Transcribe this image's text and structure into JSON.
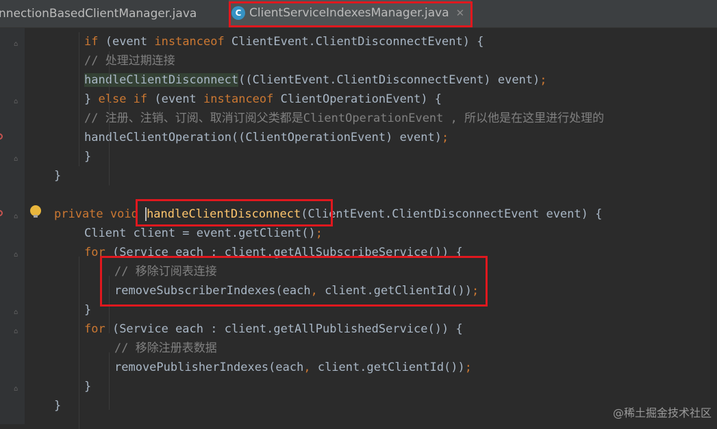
{
  "tabs": [
    {
      "label": "nnectionBasedClientManager.java"
    },
    {
      "label": "ClientServiceIndexesManager.java",
      "icon": "C",
      "close": "✕"
    }
  ],
  "code": {
    "lines": [
      [
        [
          "if",
          "kw"
        ],
        [
          " (event ",
          ""
        ],
        [
          "instanceof",
          "kw"
        ],
        [
          " ClientEvent.ClientDisconnectEvent) {",
          ""
        ]
      ],
      [
        [
          "// 处理过期连接",
          "cm"
        ]
      ],
      [
        [
          "handleClientDisconnect",
          "hl"
        ],
        [
          "((ClientEvent.ClientDisconnectEvent) event)",
          ""
        ],
        [
          ";",
          "sc"
        ]
      ],
      [
        [
          "} ",
          ""
        ],
        [
          "else if",
          "kw"
        ],
        [
          " (event ",
          ""
        ],
        [
          "instanceof",
          "kw"
        ],
        [
          " ClientOperationEvent) {",
          ""
        ]
      ],
      [
        [
          "// 注册、注销、订阅、取消订阅父类都是ClientOperationEvent , 所以他是在这里进行处理的",
          "cm"
        ]
      ],
      [
        [
          "handleClientOperation((ClientOperationEvent) event)",
          ""
        ],
        [
          ";",
          "sc"
        ]
      ],
      [
        [
          "}",
          ""
        ]
      ],
      [
        [
          "}",
          ""
        ]
      ],
      [],
      [
        [
          "private void ",
          "kw"
        ],
        [
          "handleClientDisconnect",
          "fn"
        ],
        [
          "(ClientEvent.ClientDisconnectEvent event) {",
          ""
        ]
      ],
      [
        [
          "Client client = event.getClient()",
          ""
        ],
        [
          ";",
          "sc"
        ]
      ],
      [
        [
          "for",
          "kw"
        ],
        [
          " (Service each : client.getAllSubscribeService()) {",
          ""
        ]
      ],
      [
        [
          "// 移除订阅表连接",
          "cm"
        ]
      ],
      [
        [
          "removeSubscriberIndexes(each",
          ""
        ],
        [
          ",",
          "sc"
        ],
        [
          " client.getClientId())",
          ""
        ],
        [
          ";",
          "sc"
        ]
      ],
      [
        [
          "}",
          ""
        ]
      ],
      [
        [
          "for",
          "kw"
        ],
        [
          " (Service each : client.getAllPublishedService()) {",
          ""
        ]
      ],
      [
        [
          "// 移除注册表数据",
          "cm"
        ]
      ],
      [
        [
          "removePublisherIndexes(each",
          ""
        ],
        [
          ",",
          "sc"
        ],
        [
          " client.getClientId())",
          ""
        ],
        [
          ";",
          "sc"
        ]
      ],
      [
        [
          "}",
          ""
        ]
      ],
      [
        [
          "}",
          ""
        ]
      ]
    ],
    "indents": [
      2,
      3,
      3,
      2,
      3,
      3,
      2,
      1,
      0,
      1,
      2,
      2,
      3,
      3,
      2,
      2,
      3,
      3,
      2,
      1
    ]
  },
  "watermark": "@稀土掘金技术社区",
  "colors": {
    "keyword": "#cc7832",
    "comment": "#808080",
    "function": "#ffc66d",
    "highlight": "#e0181e"
  }
}
